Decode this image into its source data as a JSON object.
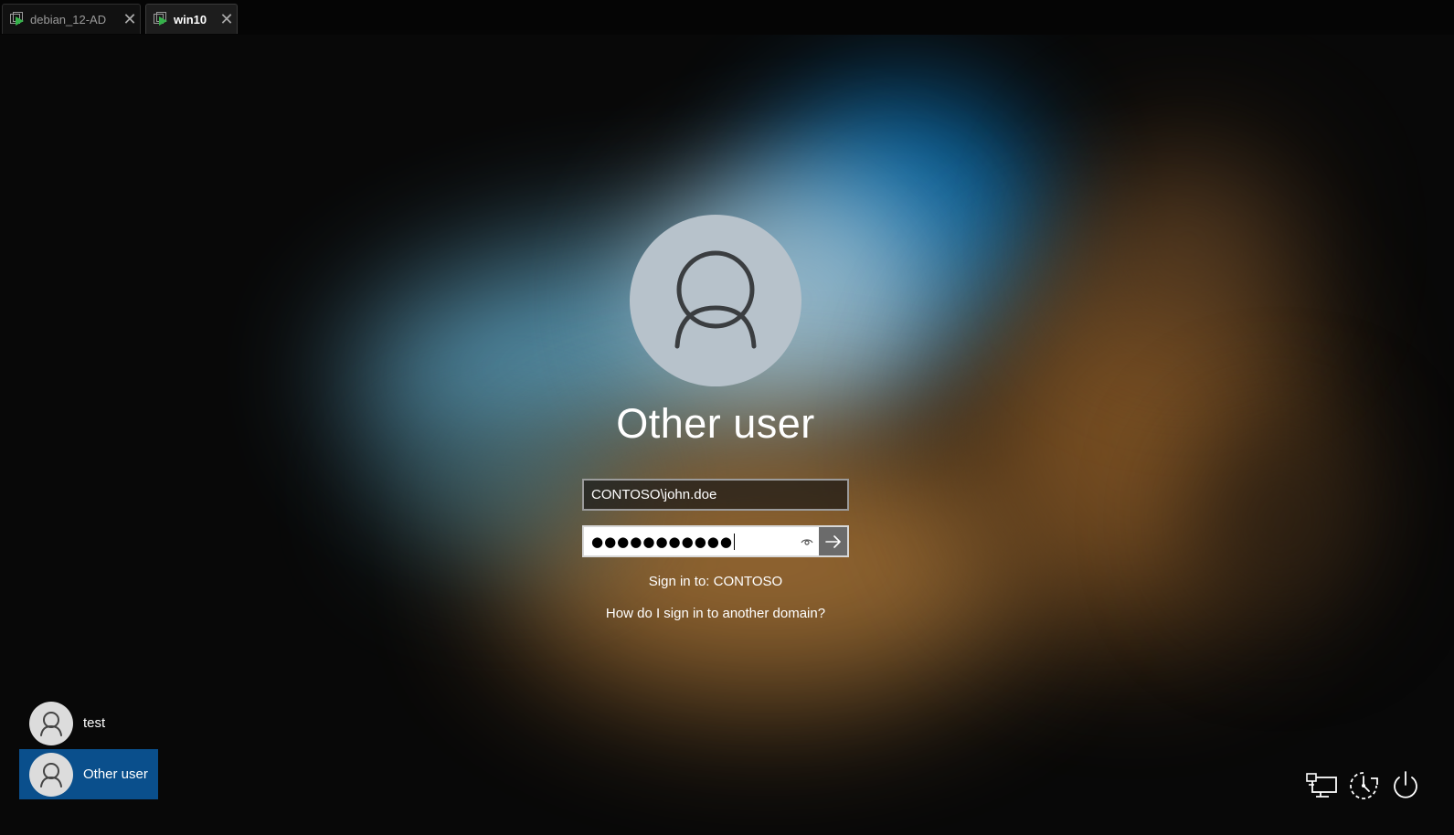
{
  "tabs": [
    {
      "label": "debian_12-AD",
      "active": false
    },
    {
      "label": "win10",
      "active": true
    }
  ],
  "signin": {
    "user_title": "Other user",
    "username_value": "CONTOSO\\john.doe",
    "password_mask": "●●●●●●●●●●●",
    "signin_to": "Sign in to: CONTOSO",
    "other_domain_link": "How do I sign in to another domain?"
  },
  "user_list": [
    {
      "label": "test",
      "selected": false
    },
    {
      "label": "Other user",
      "selected": true
    }
  ],
  "icons": {
    "tab": "vm-play-icon",
    "close": "close-icon",
    "avatar": "user-silhouette-icon",
    "reveal": "eye-icon",
    "submit": "arrow-right-icon",
    "network": "network-icon",
    "accessibility": "ease-of-access-icon",
    "power": "power-icon"
  },
  "colors": {
    "selected_user_bg": "#0a4f8c",
    "avatar_bg": "#b7c2cb",
    "submit_bg": "#6b6b6b",
    "vm_play": "#35b24a"
  }
}
